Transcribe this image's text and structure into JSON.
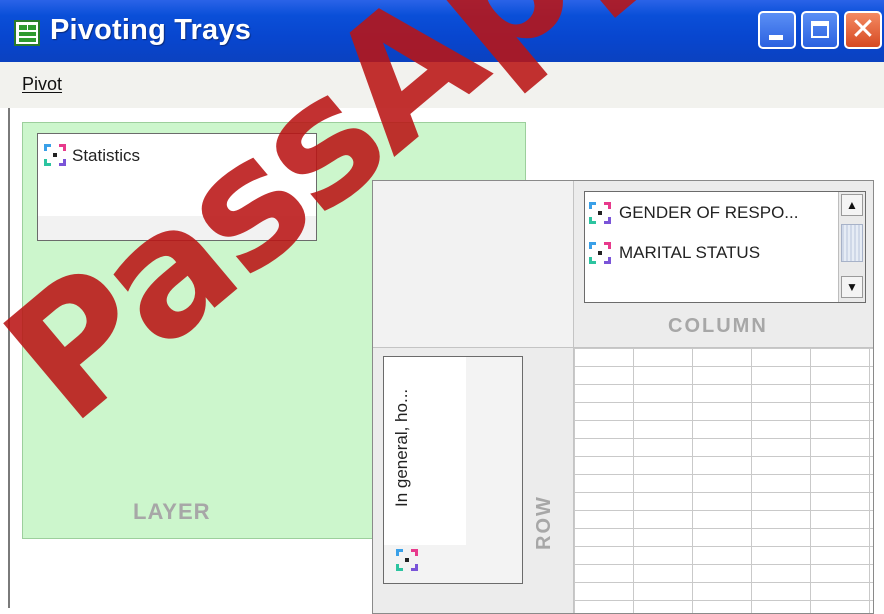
{
  "window": {
    "title": "Pivoting Trays",
    "buttons": [
      "minimize",
      "maximize",
      "close"
    ]
  },
  "menu": {
    "items": [
      {
        "label": "Pivot",
        "mnemonic": "P"
      }
    ]
  },
  "layer": {
    "label": "LAYER",
    "items": [
      {
        "label": "Statistics",
        "icon": "pivot-icon"
      }
    ]
  },
  "column": {
    "label": "COLUMN",
    "items": [
      {
        "label": "GENDER OF RESPO...",
        "icon": "pivot-icon"
      },
      {
        "label": "MARITAL STATUS",
        "icon": "pivot-icon"
      }
    ]
  },
  "row": {
    "label": "ROW",
    "items": [
      {
        "label": "In general, ho...",
        "icon": "pivot-icon"
      }
    ]
  },
  "watermark": "PassApp",
  "colors": {
    "titlebar": "#0a4fd8",
    "layer_bg": "#ccf6cc",
    "tray_label": "#a7a7a7",
    "watermark": "#b91414"
  }
}
